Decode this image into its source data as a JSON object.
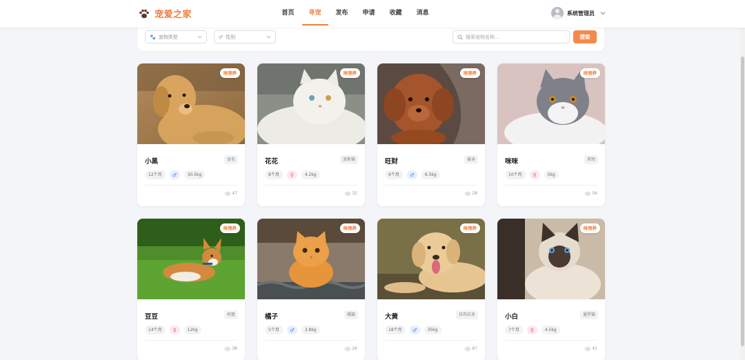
{
  "app": {
    "title": "宠爱之家"
  },
  "nav": [
    "首页",
    "寻宠",
    "发布",
    "申请",
    "收藏",
    "消息"
  ],
  "nav_active": 1,
  "user": {
    "name": "系统管理员"
  },
  "filters": {
    "pet_type": "宠物类型",
    "gender": "性别",
    "search_placeholder": "搜索宠物名称...",
    "search_button": "搜索"
  },
  "colors": {
    "accent": "#f07d3c",
    "button": "#f4894b",
    "male": "#4b7bd8",
    "female": "#e04f8a"
  },
  "cards": [
    {
      "name": "小黑",
      "breed": "金毛",
      "age": "12个月",
      "gender": "male",
      "weight": "30.5kg",
      "views": "47",
      "tag": "待领养",
      "photo": "golden-retriever"
    },
    {
      "name": "花花",
      "breed": "波斯猫",
      "age": "8个月",
      "gender": "female",
      "weight": "4.2kg",
      "views": "32",
      "tag": "待领养",
      "photo": "white-persian-cat"
    },
    {
      "name": "旺财",
      "breed": "泰迪",
      "age": "6个月",
      "gender": "male",
      "weight": "6.5kg",
      "views": "28",
      "tag": "待领养",
      "photo": "brown-poodle"
    },
    {
      "name": "咪咪",
      "breed": "英短",
      "age": "10个月",
      "gender": "female",
      "weight": "5kg",
      "views": "56",
      "tag": "待领养",
      "photo": "british-shorthair"
    },
    {
      "name": "豆豆",
      "breed": "柯基",
      "age": "14个月",
      "gender": "female",
      "weight": "12kg",
      "views": "38",
      "tag": "待领养",
      "photo": "corgi-on-grass"
    },
    {
      "name": "橘子",
      "breed": "橘猫",
      "age": "5个月",
      "gender": "male",
      "weight": "3.8kg",
      "views": "26",
      "tag": "待领养",
      "photo": "orange-cat-on-roof"
    },
    {
      "name": "大黄",
      "breed": "拉布拉多",
      "age": "18个月",
      "gender": "male",
      "weight": "35kg",
      "views": "67",
      "tag": "待领养",
      "photo": "labrador"
    },
    {
      "name": "小白",
      "breed": "暹罗猫",
      "age": "7个月",
      "gender": "female",
      "weight": "4.5kg",
      "views": "41",
      "tag": "待领养",
      "photo": "siamese-cat"
    }
  ]
}
